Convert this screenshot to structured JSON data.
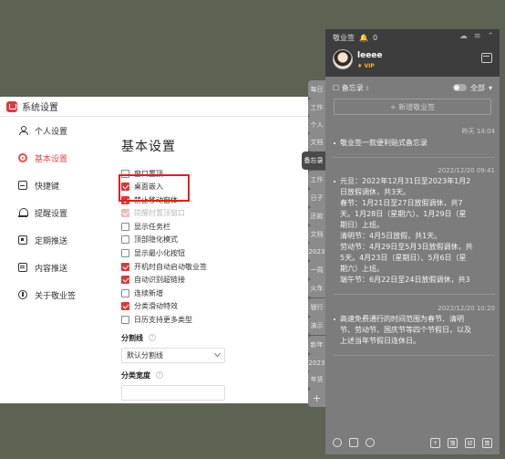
{
  "settings": {
    "title": "系统设置",
    "nav": [
      {
        "label": "个人设置",
        "icon": "person-icon"
      },
      {
        "label": "基本设置",
        "icon": "gear-icon",
        "active": true
      },
      {
        "label": "快捷键",
        "icon": "keyboard-icon"
      },
      {
        "label": "提醒设置",
        "icon": "bell-icon"
      },
      {
        "label": "定期推送",
        "icon": "push-icon"
      },
      {
        "label": "内容推送",
        "icon": "content-icon"
      },
      {
        "label": "关于敬业签",
        "icon": "info-icon"
      }
    ],
    "heading": "基本设置",
    "options": [
      {
        "label": "窗口置顶",
        "checked": false
      },
      {
        "label": "桌面嵌入",
        "checked": true
      },
      {
        "label": "禁止移动窗体",
        "checked": true
      },
      {
        "label": "提醒时置顶窗口",
        "checked": true,
        "disabled": true
      },
      {
        "label": "显示任务栏",
        "checked": false
      },
      {
        "label": "顶部隐化模式",
        "checked": false
      },
      {
        "label": "显示最小化按钮",
        "checked": false
      },
      {
        "label": "开机时自动启动敬业签",
        "checked": true
      },
      {
        "label": "自动识别超链接",
        "checked": true
      },
      {
        "label": "连续新增",
        "checked": false
      },
      {
        "label": "分类滑动特效",
        "checked": true
      },
      {
        "label": "日历支持更多类型",
        "checked": false
      }
    ],
    "divider_label": "分割线",
    "divider_value": "默认分割线",
    "width_label": "分类宽度",
    "help_glyph": "?"
  },
  "tabs": [
    "每日",
    "工作",
    "个人",
    "文档",
    "备忘录",
    "工作",
    "日子",
    "还款",
    "文档",
    "2023",
    "一周",
    "火车",
    "银行",
    "演示",
    "新年",
    "2023",
    "年货"
  ],
  "active_tab_index": 4,
  "tab_add": "+",
  "panel": {
    "app_name": "敬业签",
    "bell_count": "0",
    "user_name": "leeee",
    "vip": "VIP",
    "list_title": "备忘录",
    "list_count": "3",
    "filter": "全部",
    "new_button": "+ 新增敬业签",
    "notes": [
      {
        "date": "昨天 14:04",
        "lines": [
          "敬业签一款便利贴式备忘录"
        ]
      },
      {
        "date": "2022/12/20 09:41",
        "lines": [
          "元旦：2022年12月31日至2023年1月2",
          "日放假调休，共3天。",
          "春节：1月21日至27日放假调休，共7",
          "天。1月28日（星期六）、1月29日（星",
          "期日）上班。",
          "清明节：4月5日放假，共1天。",
          "劳动节：4月29日至5月3日放假调休，共",
          "5天。4月23日（星期日）、5月6日（星",
          "期六）上班。",
          "端午节：6月22日至24日放假调休，共3"
        ]
      },
      {
        "date": "2022/12/20 10:20",
        "lines": [
          "高速免费通行的时间范围为春节、清明",
          "节、劳动节、国庆节等四个节假日，以及",
          "上述当年节假日连休日。"
        ]
      }
    ],
    "bottom_icons": [
      "clock-icon",
      "calendar-icon",
      "search-icon",
      "add-icon",
      "list-icon",
      "stamp-icon",
      "calc-icon"
    ],
    "bottom_glyphs": [
      "+",
      "簿",
      "印",
      "算"
    ]
  }
}
